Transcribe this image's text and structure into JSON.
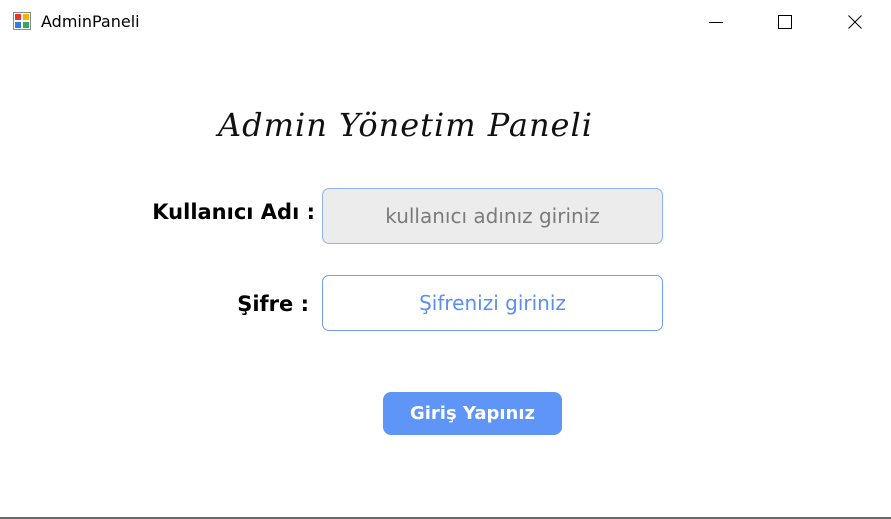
{
  "window": {
    "title": "AdminPaneli",
    "icon": "winforms-app-icon",
    "controls": {
      "minimize_icon": "minimize-icon",
      "maximize_icon": "maximize-icon",
      "close_icon": "close-icon"
    }
  },
  "panel": {
    "heading": "Admin Yönetim Paneli"
  },
  "form": {
    "username_label": "Kullanıcı Adı :",
    "username_placeholder": "kullanıcı adınız giriniz",
    "username_value": "",
    "password_label": "Şifre :",
    "password_placeholder": "Şifrenizi giriniz",
    "password_value": "",
    "submit_label": "Giriş Yapınız"
  },
  "colors": {
    "accent": "#5f95f6",
    "username_field_bg": "#ececec",
    "password_placeholder": "#5b8ef0"
  }
}
